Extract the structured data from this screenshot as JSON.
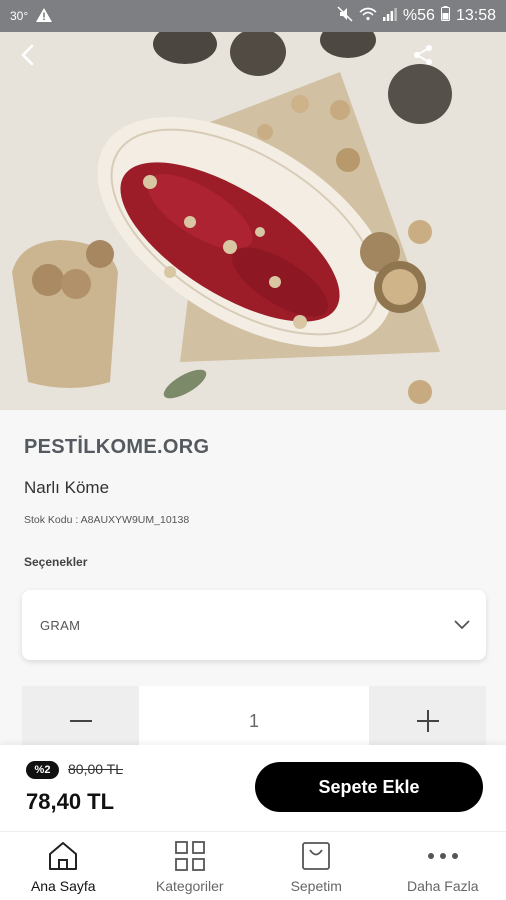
{
  "status_bar": {
    "temperature": "30°",
    "battery": "%56",
    "time": "13:58"
  },
  "product": {
    "brand": "PESTİLKOME.ORG",
    "name": "Narlı Köme",
    "sku": "Stok Kodu : A8AUXYW9UM_10138",
    "options_label": "Seçenekler",
    "option_selected": "GRAM",
    "quantity": "1"
  },
  "pricing": {
    "discount_badge": "%2",
    "old_price": "80,00 TL",
    "price": "78,40 TL",
    "add_to_cart": "Sepete Ekle"
  },
  "tabs": [
    {
      "label": "Ana Sayfa",
      "icon": "home-icon",
      "active": true
    },
    {
      "label": "Kategoriler",
      "icon": "grid-icon",
      "active": false
    },
    {
      "label": "Sepetim",
      "icon": "bag-icon",
      "active": false
    },
    {
      "label": "Daha Fazla",
      "icon": "more-icon",
      "active": false
    }
  ],
  "colors": {
    "status_bar": "#7d7f82",
    "accent": "#000000",
    "panel_bg": "#f7f7f7"
  }
}
